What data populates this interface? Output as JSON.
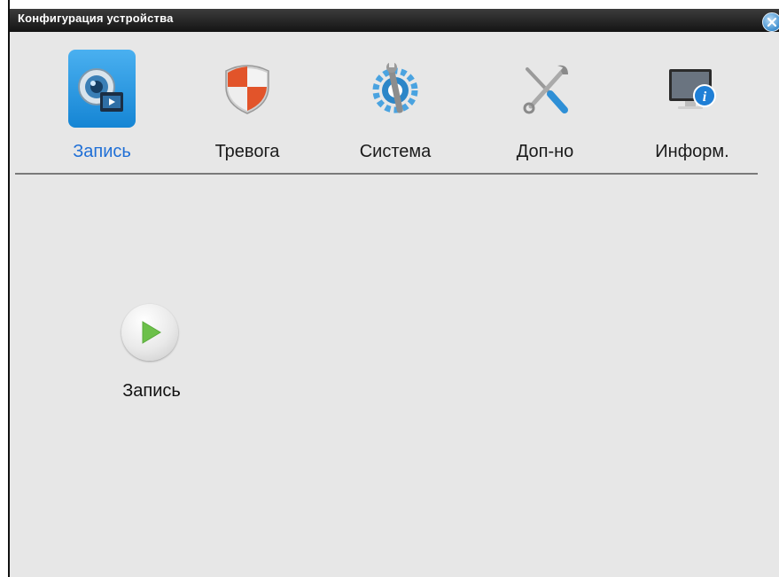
{
  "window": {
    "title": "Конфигурация устройства",
    "close_icon": "close-icon"
  },
  "tabs": [
    {
      "label": "Запись",
      "icon": "record-camera-icon",
      "selected": true
    },
    {
      "label": "Тревога",
      "icon": "alarm-shield-icon",
      "selected": false
    },
    {
      "label": "Система",
      "icon": "system-gear-wrench-icon",
      "selected": false
    },
    {
      "label": "Доп-но",
      "icon": "tools-icon",
      "selected": false
    },
    {
      "label": "Информ.",
      "icon": "info-monitor-icon",
      "selected": false
    }
  ],
  "content": {
    "items": [
      {
        "label": "Запись",
        "icon": "play-icon"
      }
    ]
  },
  "colors": {
    "accent": "#1f6fd6",
    "selected_tab_bg": "#2a98e2",
    "background": "#e7e7e7",
    "titlebar": "#1e1e1e",
    "play_green": "#6cc04a"
  }
}
